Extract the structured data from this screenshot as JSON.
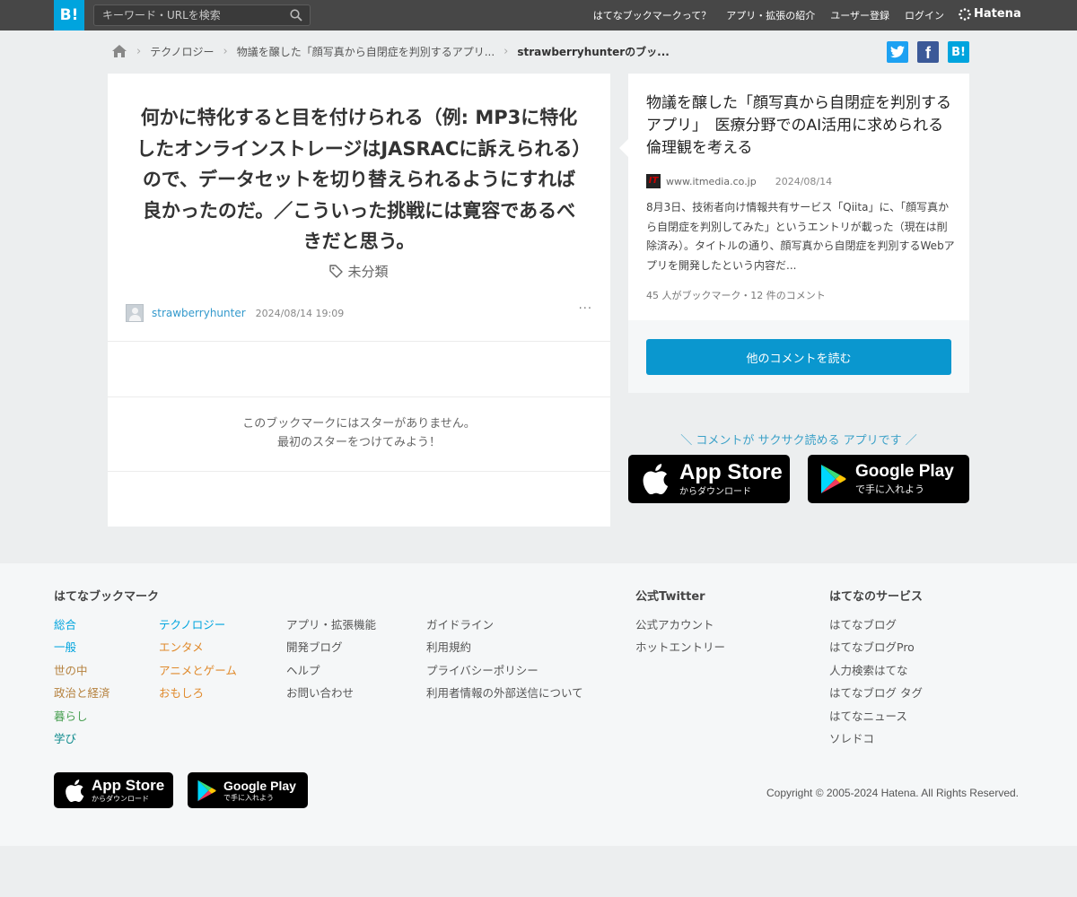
{
  "header": {
    "logo": "B!",
    "search_placeholder": "キーワード・URLを検索",
    "nav": [
      "はてなブックマークって？",
      "アプリ・拡張の紹介",
      "ユーザー登録",
      "ログイン"
    ],
    "brand": "Hatena"
  },
  "breadcrumb": {
    "items": [
      "テクノロジー",
      "物議を醸した「顔写真から自閉症を判別するアプリ...",
      "strawberryhunterのブッ..."
    ]
  },
  "share": {
    "twitter": "t",
    "facebook": "f",
    "hatena": "B!"
  },
  "bookmark": {
    "comment": "何かに特化すると目を付けられる（例: MP3に特化したオンラインストレージはJASRACに訴えられる）ので、データセットを切り替えられるようにすれば良かったのだ。／こういった挑戦には寛容であるべきだと思う。",
    "tag": "未分類",
    "user": "strawberryhunter",
    "timestamp": "2024/08/14 19:09",
    "more": "···",
    "no_stars_line1": "このブックマークにはスターがありません。",
    "no_stars_line2": "最初のスターをつけてみよう！"
  },
  "entry": {
    "title": "物議を醸した「顔写真から自閉症を判別するアプリ」　医療分野でのAI活用に求められる倫理観を考える",
    "favicon": "IT",
    "domain": "www.itmedia.co.jp",
    "date": "2024/08/14",
    "description": "8月3日、技術者向け情報共有サービス「Qiita」に、「顔写真から自閉症を判別してみた」というエントリが載った（現在は削除済み）。タイトルの通り、顔写真から自閉症を判別するWebアプリを開発したという内容だ...",
    "stats": "45 人がブックマーク・12 件のコメント",
    "read_comments": "他のコメントを読む"
  },
  "promo": {
    "text": "＼ コメントが サクサク読める アプリです ／",
    "appstore_title": "App Store",
    "appstore_sub": "からダウンロード",
    "googleplay_title": "Google Play",
    "googleplay_sub": "で手に入れよう"
  },
  "footer": {
    "col1_title": "はてなブックマーク",
    "categories_a": [
      "総合",
      "一般",
      "世の中",
      "政治と経済",
      "暮らし",
      "学び"
    ],
    "categories_b": [
      "テクノロジー",
      "エンタメ",
      "アニメとゲーム",
      "おもしろ"
    ],
    "links_c": [
      "アプリ・拡張機能",
      "開発ブログ",
      "ヘルプ",
      "お問い合わせ"
    ],
    "links_d": [
      "ガイドライン",
      "利用規約",
      "プライバシーポリシー",
      "利用者情報の外部送信について"
    ],
    "twitter_title": "公式Twitter",
    "twitter_links": [
      "公式アカウント",
      "ホットエントリー"
    ],
    "services_title": "はてなのサービス",
    "services_links": [
      "はてなブログ",
      "はてなブログPro",
      "人力検索はてな",
      "はてなブログ タグ",
      "はてなニュース",
      "ソレドコ"
    ],
    "copyright": "Copyright © 2005-2024 Hatena. All Rights Reserved."
  },
  "colors": {
    "accent": "#00a4de",
    "header_bg": "#474747",
    "button": "#0a97cf"
  }
}
